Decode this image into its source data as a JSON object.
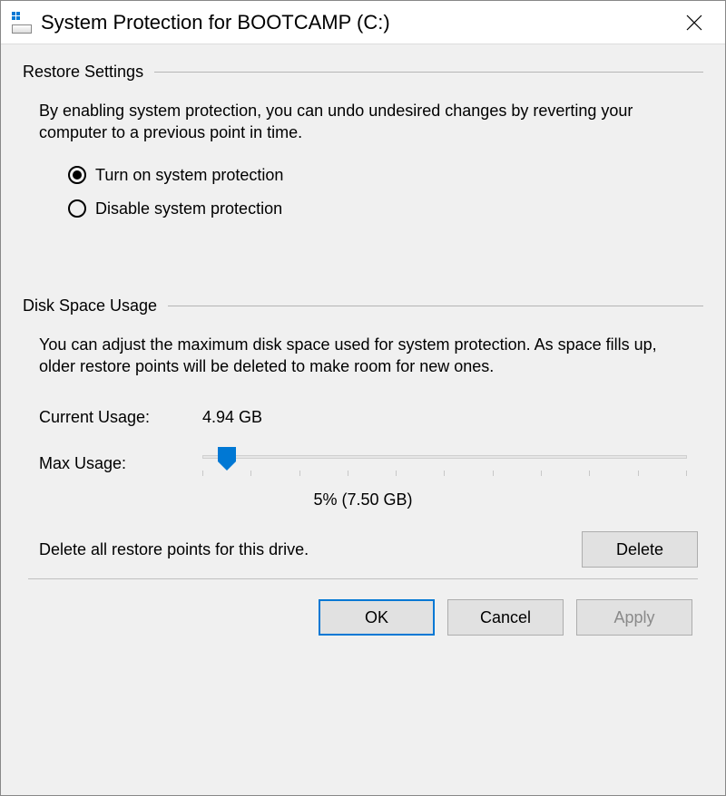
{
  "window": {
    "title": "System Protection for BOOTCAMP (C:)"
  },
  "restore": {
    "header": "Restore Settings",
    "description": "By enabling system protection, you can undo undesired changes by reverting your computer to a previous point in time.",
    "option_on": "Turn on system protection",
    "option_off": "Disable system protection",
    "selected": "on"
  },
  "disk": {
    "header": "Disk Space Usage",
    "description": "You can adjust the maximum disk space used for system protection. As space fills up, older restore points will be deleted to make room for new ones.",
    "current_label": "Current Usage:",
    "current_value": "4.94 GB",
    "max_label": "Max Usage:",
    "slider_percent": 5,
    "slider_display": "5% (7.50 GB)",
    "delete_text": "Delete all restore points for this drive.",
    "delete_button": "Delete"
  },
  "buttons": {
    "ok": "OK",
    "cancel": "Cancel",
    "apply": "Apply"
  }
}
